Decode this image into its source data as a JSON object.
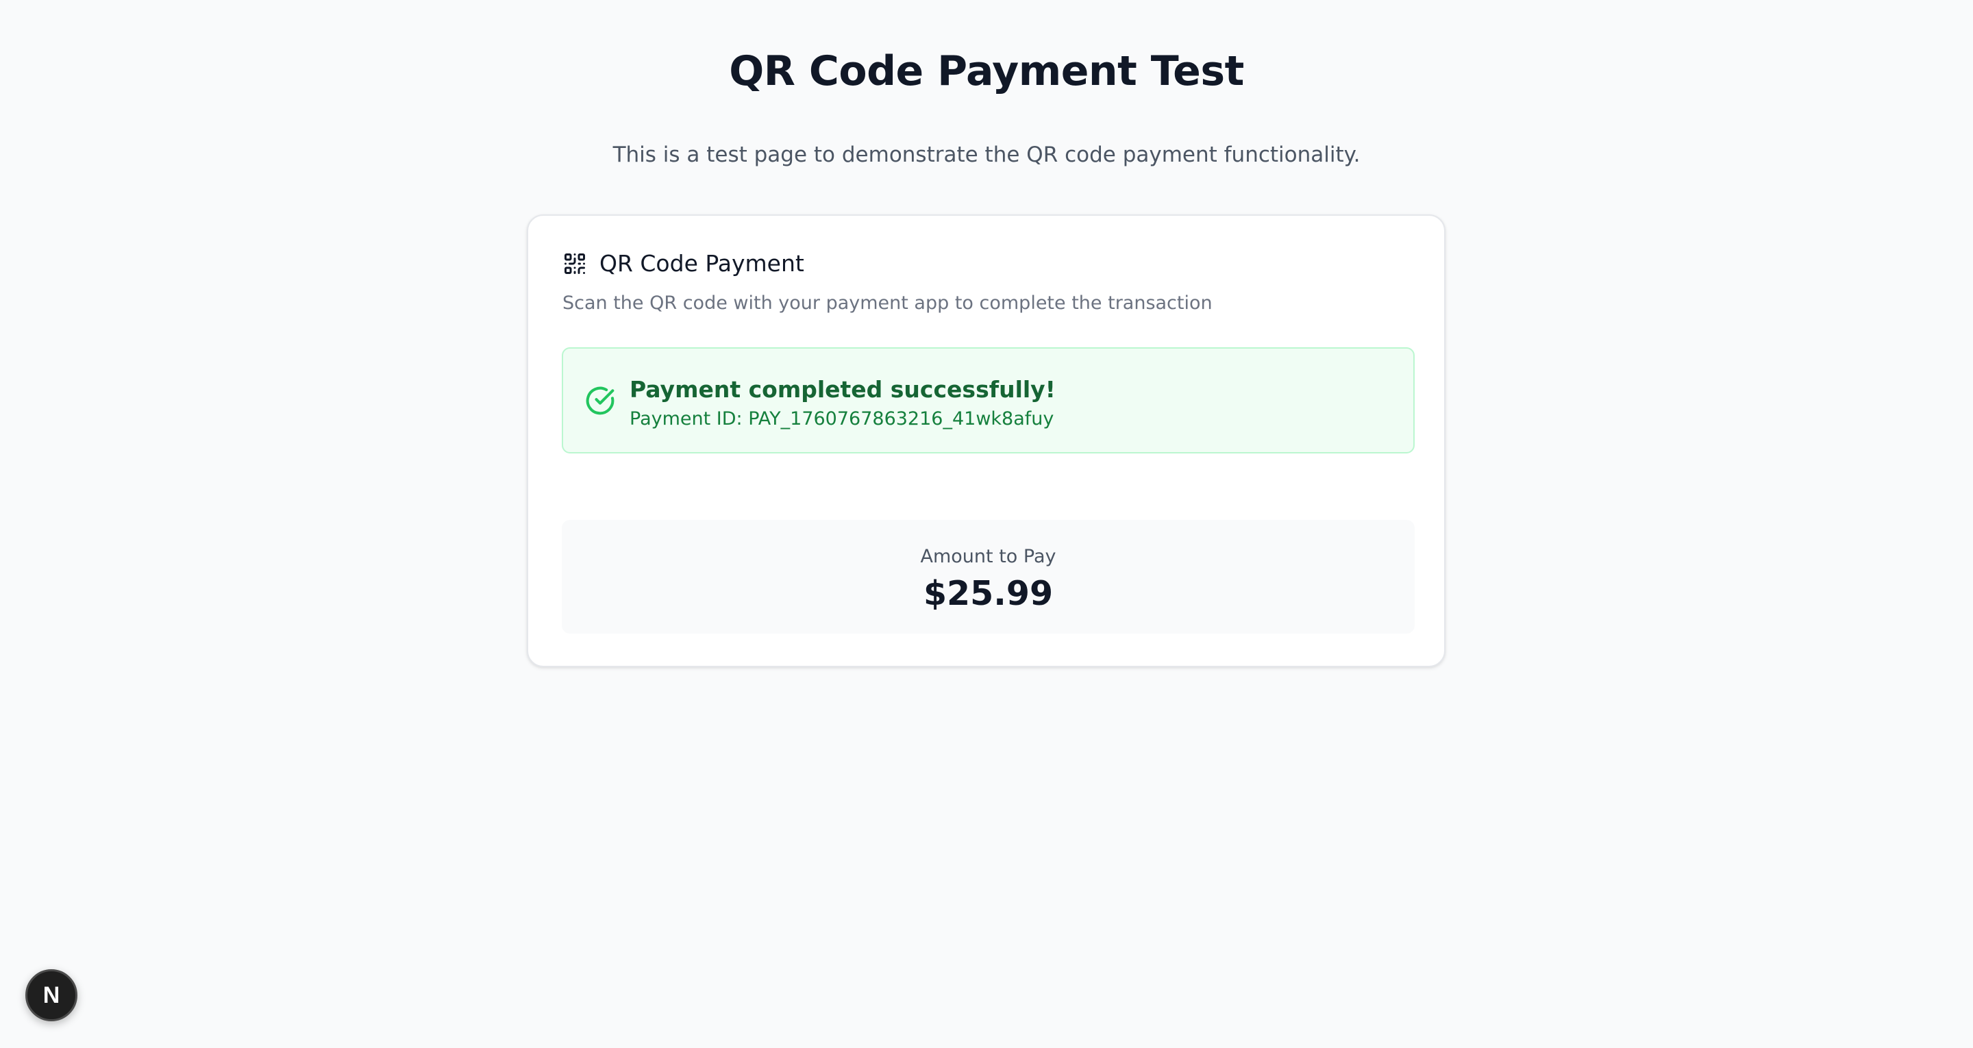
{
  "page": {
    "title": "QR Code Payment Test",
    "subtitle": "This is a test page to demonstrate the QR code payment functionality."
  },
  "card": {
    "icon": "qr-code-icon",
    "title": "QR Code Payment",
    "description": "Scan the QR code with your payment app to complete the transaction"
  },
  "status": {
    "icon": "check-circle-icon",
    "title": "Payment completed successfully!",
    "payment_id": "Payment ID: PAY_1760767863216_41wk8afuy",
    "color": "#16a34a"
  },
  "amount": {
    "label": "Amount to Pay",
    "value": "$25.99"
  },
  "dev_badge": {
    "letter": "N",
    "icon": "nextjs-logo-icon"
  },
  "colors": {
    "background": "#f9fafb",
    "success_bg": "#f0fdf4",
    "success_border": "#bbf7d0",
    "success_text": "#166534"
  }
}
